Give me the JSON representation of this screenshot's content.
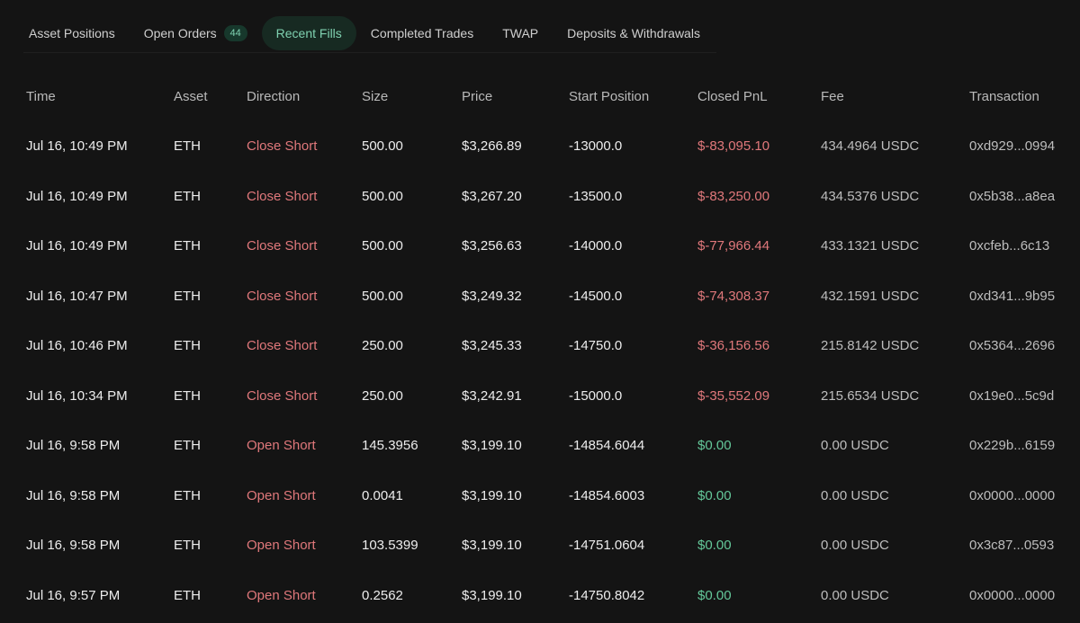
{
  "tabs": [
    {
      "label": "Asset Positions",
      "badge": null,
      "active": false
    },
    {
      "label": "Open Orders",
      "badge": "44",
      "active": false
    },
    {
      "label": "Recent Fills",
      "badge": null,
      "active": true
    },
    {
      "label": "Completed Trades",
      "badge": null,
      "active": false
    },
    {
      "label": "TWAP",
      "badge": null,
      "active": false
    },
    {
      "label": "Deposits & Withdrawals",
      "badge": null,
      "active": false
    }
  ],
  "colors": {
    "negative": "#e0787b",
    "positive": "#64c89a",
    "accent": "#7fd1b0"
  },
  "columns": {
    "time": "Time",
    "asset": "Asset",
    "direction": "Direction",
    "size": "Size",
    "price": "Price",
    "start_position": "Start Position",
    "closed_pnl": "Closed PnL",
    "fee": "Fee",
    "transaction": "Transaction"
  },
  "rows": [
    {
      "time": "Jul 16, 10:49 PM",
      "asset": "ETH",
      "direction": "Close Short",
      "size": "500.00",
      "price": "$3,266.89",
      "start_position": "-13000.0",
      "closed_pnl": "$-83,095.10",
      "pnl_sign": "neg",
      "fee": "434.4964 USDC",
      "transaction": "0xd929...0994"
    },
    {
      "time": "Jul 16, 10:49 PM",
      "asset": "ETH",
      "direction": "Close Short",
      "size": "500.00",
      "price": "$3,267.20",
      "start_position": "-13500.0",
      "closed_pnl": "$-83,250.00",
      "pnl_sign": "neg",
      "fee": "434.5376 USDC",
      "transaction": "0x5b38...a8ea"
    },
    {
      "time": "Jul 16, 10:49 PM",
      "asset": "ETH",
      "direction": "Close Short",
      "size": "500.00",
      "price": "$3,256.63",
      "start_position": "-14000.0",
      "closed_pnl": "$-77,966.44",
      "pnl_sign": "neg",
      "fee": "433.1321 USDC",
      "transaction": "0xcfeb...6c13"
    },
    {
      "time": "Jul 16, 10:47 PM",
      "asset": "ETH",
      "direction": "Close Short",
      "size": "500.00",
      "price": "$3,249.32",
      "start_position": "-14500.0",
      "closed_pnl": "$-74,308.37",
      "pnl_sign": "neg",
      "fee": "432.1591 USDC",
      "transaction": "0xd341...9b95"
    },
    {
      "time": "Jul 16, 10:46 PM",
      "asset": "ETH",
      "direction": "Close Short",
      "size": "250.00",
      "price": "$3,245.33",
      "start_position": "-14750.0",
      "closed_pnl": "$-36,156.56",
      "pnl_sign": "neg",
      "fee": "215.8142 USDC",
      "transaction": "0x5364...2696"
    },
    {
      "time": "Jul 16, 10:34 PM",
      "asset": "ETH",
      "direction": "Close Short",
      "size": "250.00",
      "price": "$3,242.91",
      "start_position": "-15000.0",
      "closed_pnl": "$-35,552.09",
      "pnl_sign": "neg",
      "fee": "215.6534 USDC",
      "transaction": "0x19e0...5c9d"
    },
    {
      "time": "Jul 16, 9:58 PM",
      "asset": "ETH",
      "direction": "Open Short",
      "size": "145.3956",
      "price": "$3,199.10",
      "start_position": "-14854.6044",
      "closed_pnl": "$0.00",
      "pnl_sign": "pos",
      "fee": "0.00 USDC",
      "transaction": "0x229b...6159"
    },
    {
      "time": "Jul 16, 9:58 PM",
      "asset": "ETH",
      "direction": "Open Short",
      "size": "0.0041",
      "price": "$3,199.10",
      "start_position": "-14854.6003",
      "closed_pnl": "$0.00",
      "pnl_sign": "pos",
      "fee": "0.00 USDC",
      "transaction": "0x0000...0000"
    },
    {
      "time": "Jul 16, 9:58 PM",
      "asset": "ETH",
      "direction": "Open Short",
      "size": "103.5399",
      "price": "$3,199.10",
      "start_position": "-14751.0604",
      "closed_pnl": "$0.00",
      "pnl_sign": "pos",
      "fee": "0.00 USDC",
      "transaction": "0x3c87...0593"
    },
    {
      "time": "Jul 16, 9:57 PM",
      "asset": "ETH",
      "direction": "Open Short",
      "size": "0.2562",
      "price": "$3,199.10",
      "start_position": "-14750.8042",
      "closed_pnl": "$0.00",
      "pnl_sign": "pos",
      "fee": "0.00 USDC",
      "transaction": "0x0000...0000"
    }
  ]
}
